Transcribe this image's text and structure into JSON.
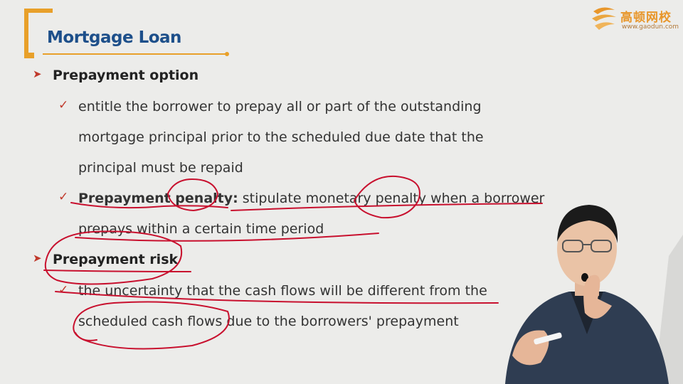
{
  "header": {
    "title": "Mortgage Loan"
  },
  "logo": {
    "name": "高顿网校",
    "url": "www.gaodun.com"
  },
  "content": {
    "bullet1": "Prepayment option",
    "bullet1_sub1_line1": "entitle the borrower to prepay all or part of the outstanding",
    "bullet1_sub1_line2": "mortgage principal prior to the scheduled due date that the",
    "bullet1_sub1_line3": "principal must be repaid",
    "bullet1_sub2_term": "Prepayment penalty:",
    "bullet1_sub2_text": " stipulate monetary penalty when a borrower",
    "bullet1_sub2_line2": "prepays within a certain time period",
    "bullet2": "Prepayment risk",
    "bullet2_sub1_line1": "the uncertainty that the cash flows will be different from the",
    "bullet2_sub1_line2": "scheduled cash flows due to the borrowers' prepayment"
  },
  "colors": {
    "title": "#1d4f8a",
    "accent": "#e8a02a",
    "annotation": "#c8102e",
    "bullet": "#c0392b"
  },
  "icons": {
    "bullet1": "arrowhead-bullet-icon",
    "sub_bullet": "checkmark-icon",
    "logo": "gaodun-logo-icon"
  }
}
